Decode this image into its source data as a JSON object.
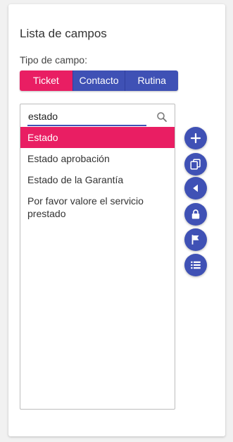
{
  "panel": {
    "title": "Lista de campos",
    "type_label": "Tipo de campo:"
  },
  "field_types": {
    "selected": "Ticket",
    "options": [
      "Ticket",
      "Contacto",
      "Rutina"
    ]
  },
  "search": {
    "value": "estado",
    "icon": "search-icon"
  },
  "fields": {
    "selected_index": 0,
    "items": [
      "Estado",
      "Estado aprobación",
      "Estado de la Garantía",
      "Por favor valore el servicio prestado"
    ]
  },
  "actions": [
    {
      "name": "add",
      "icon": "plus-icon"
    },
    {
      "name": "copy",
      "icon": "copy-icon"
    },
    {
      "name": "back",
      "icon": "triangle-left-icon"
    },
    {
      "name": "lock",
      "icon": "lock-icon"
    },
    {
      "name": "flag",
      "icon": "flag-icon"
    },
    {
      "name": "list",
      "icon": "list-icon"
    }
  ],
  "colors": {
    "primary": "#3f51b5",
    "accent": "#e91e63"
  }
}
